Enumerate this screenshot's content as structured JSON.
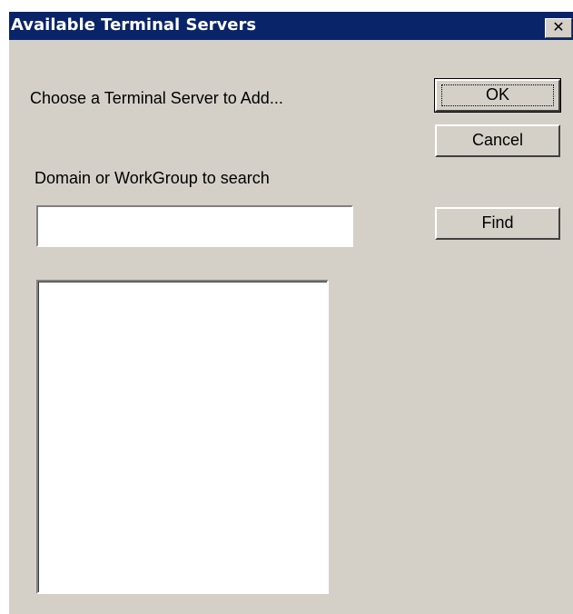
{
  "window": {
    "title": "Available Terminal Servers",
    "close_glyph": "✕",
    "colors": {
      "titlebar": "#0a246a",
      "dialog_face": "#d4d0c8",
      "title_text": "#ffffff"
    }
  },
  "prompt": {
    "choose_label": "Choose a Terminal Server to Add...",
    "domain_label": "Domain or WorkGroup to search"
  },
  "buttons": {
    "ok_label": "OK",
    "cancel_label": "Cancel",
    "find_label": "Find"
  },
  "domain_input": {
    "value": "",
    "placeholder": ""
  },
  "server_list": {
    "items": []
  }
}
